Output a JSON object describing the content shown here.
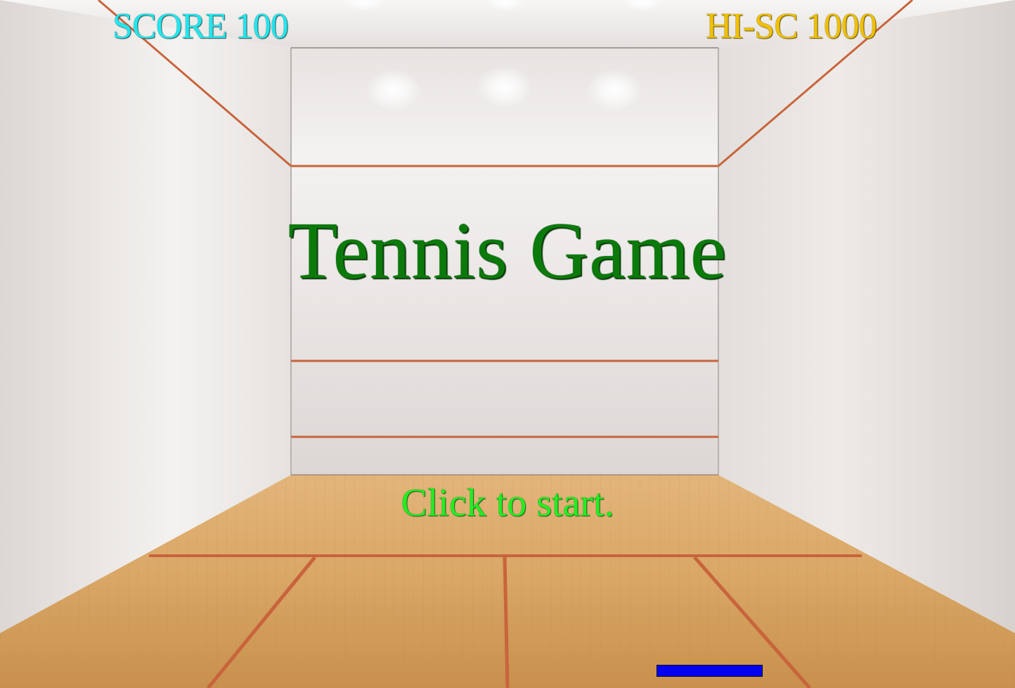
{
  "hud": {
    "score_label": "SCORE",
    "score": "100",
    "hiscore_label": "HI-SC",
    "hiscore": "1000"
  },
  "title": "Tennis Game",
  "start_prompt": "Click to start.",
  "colors": {
    "score": "#22e6ee",
    "hiscore": "#f0c000",
    "title": "#0b7a0b",
    "start_prompt": "#22ee22",
    "paddle": "#0000ee",
    "court_line": "#c8643c",
    "floor": "#d8a868",
    "wall": "#ece8e6"
  }
}
